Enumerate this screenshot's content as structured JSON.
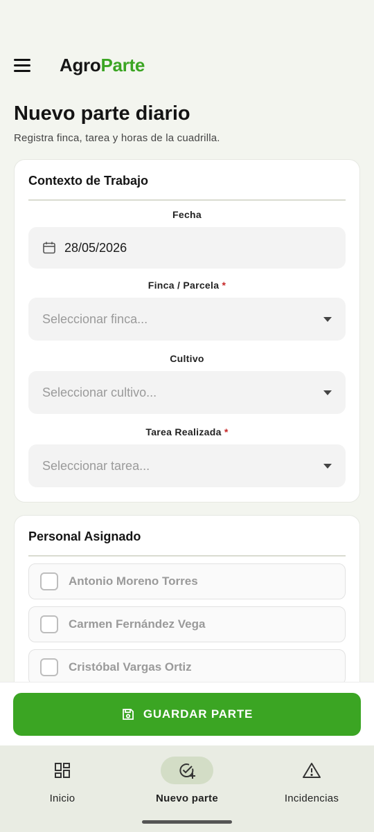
{
  "app": {
    "logo_part1": "Agro",
    "logo_part2": "Parte"
  },
  "page": {
    "title": "Nuevo parte diario",
    "subtitle": "Registra finca, tarea y horas de la cuadrilla."
  },
  "context_card": {
    "title": "Contexto de Trabajo",
    "date_label": "Fecha",
    "date_value": "28/05/2026",
    "farm_label": "Finca / Parcela",
    "farm_placeholder": "Seleccionar finca...",
    "crop_label": "Cultivo",
    "crop_placeholder": "Seleccionar cultivo...",
    "task_label": "Tarea Realizada",
    "task_placeholder": "Seleccionar tarea...",
    "required_mark": "*"
  },
  "staff_card": {
    "title": "Personal Asignado",
    "people": [
      {
        "name": "Antonio Moreno Torres"
      },
      {
        "name": "Carmen Fernández Vega"
      },
      {
        "name": "Cristóbal Vargas Ortiz"
      }
    ]
  },
  "save_button": {
    "label": "GUARDAR PARTE"
  },
  "bottom_nav": {
    "items": [
      {
        "label": "Inicio",
        "icon": "dashboard-icon"
      },
      {
        "label": "Nuevo parte",
        "icon": "add-task-icon"
      },
      {
        "label": "Incidencias",
        "icon": "warning-icon"
      }
    ]
  },
  "colors": {
    "brand_green": "#3ba523",
    "required": "#c62828"
  }
}
